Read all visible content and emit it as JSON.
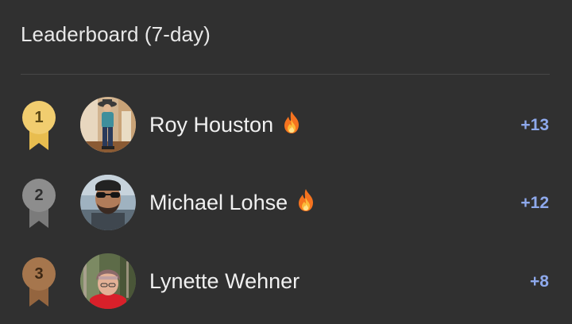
{
  "header": {
    "title": "Leaderboard (7-day)"
  },
  "colors": {
    "background": "#303030",
    "score": "#8ea9ec",
    "gold": "#f1cd6f",
    "silver": "#8d8d8d",
    "bronze": "#a6764d"
  },
  "leaderboard": [
    {
      "rank": "1",
      "medal": "gold-medal-icon",
      "name": "Roy Houston",
      "streak_icon": "fire-icon",
      "score": "+13"
    },
    {
      "rank": "2",
      "medal": "silver-medal-icon",
      "name": "Michael Lohse",
      "streak_icon": "fire-icon",
      "score": "+12"
    },
    {
      "rank": "3",
      "medal": "bronze-medal-icon",
      "name": "Lynette Wehner",
      "streak_icon": null,
      "score": "+8"
    }
  ]
}
